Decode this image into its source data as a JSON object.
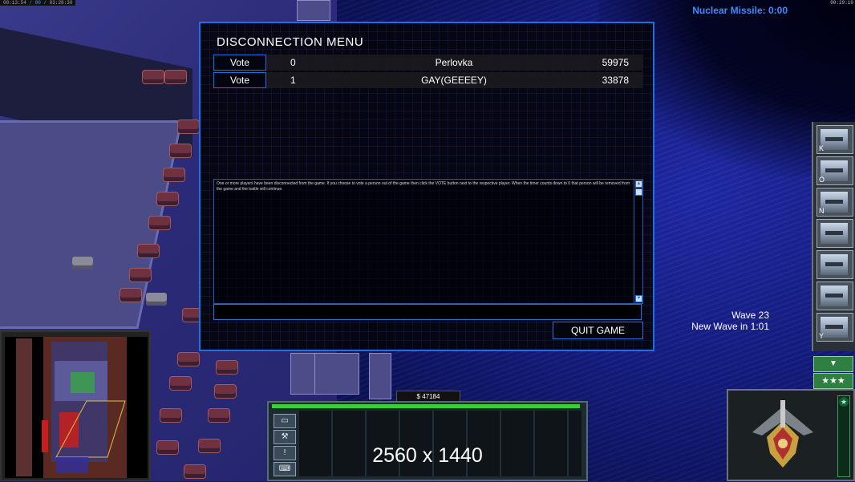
{
  "hud": {
    "top_left": {
      "prefix": "00:13:54",
      "mid": "/ 00 /",
      "time": "03:28:30"
    },
    "top_right_time": "00:29:10",
    "nuclear_missile": "Nuclear Missile: 0:00",
    "wave": "Wave 23",
    "new_wave": "New Wave in 1:01",
    "money": "$ 47184",
    "resolution_overlay": "2560 x 1440"
  },
  "dialog": {
    "title": "DISCONNECTION MENU",
    "players": [
      {
        "vote_label": "Vote",
        "slot": "0",
        "name": "Perlovka",
        "score": "59975"
      },
      {
        "vote_label": "Vote",
        "slot": "1",
        "name": "GAY(GEEEEY)",
        "score": "33878"
      }
    ],
    "message": "One or more players have been disconnected from the game. If you choose to vote a person out of the game then click the VOTE button next to the respective player. When the timer counts down to 0 that person will be removed from the game and the battle will continue.",
    "quit_label": "QUIT GAME"
  },
  "sidebar": {
    "powers": [
      {
        "hotkey": "K",
        "icon": "spy-plane-icon"
      },
      {
        "hotkey": "O",
        "icon": "fighter-jet-icon"
      },
      {
        "hotkey": "N",
        "icon": "radar-scan-icon"
      },
      {
        "hotkey": "",
        "icon": "satellite-icon"
      },
      {
        "hotkey": "",
        "icon": "artillery-strike-icon"
      },
      {
        "hotkey": "",
        "icon": "cargo-drop-icon"
      },
      {
        "hotkey": "Y",
        "icon": "drone-icon"
      }
    ],
    "collapse_glyph": "▼",
    "rank_glyph": "★★★"
  },
  "command": {
    "buttons": [
      "▭",
      "⚒",
      "!",
      "⌨"
    ]
  },
  "colors": {
    "accent_blue": "#1e6fe0",
    "nuke_text": "#3d8cff",
    "power_green": "#3ad03a"
  }
}
